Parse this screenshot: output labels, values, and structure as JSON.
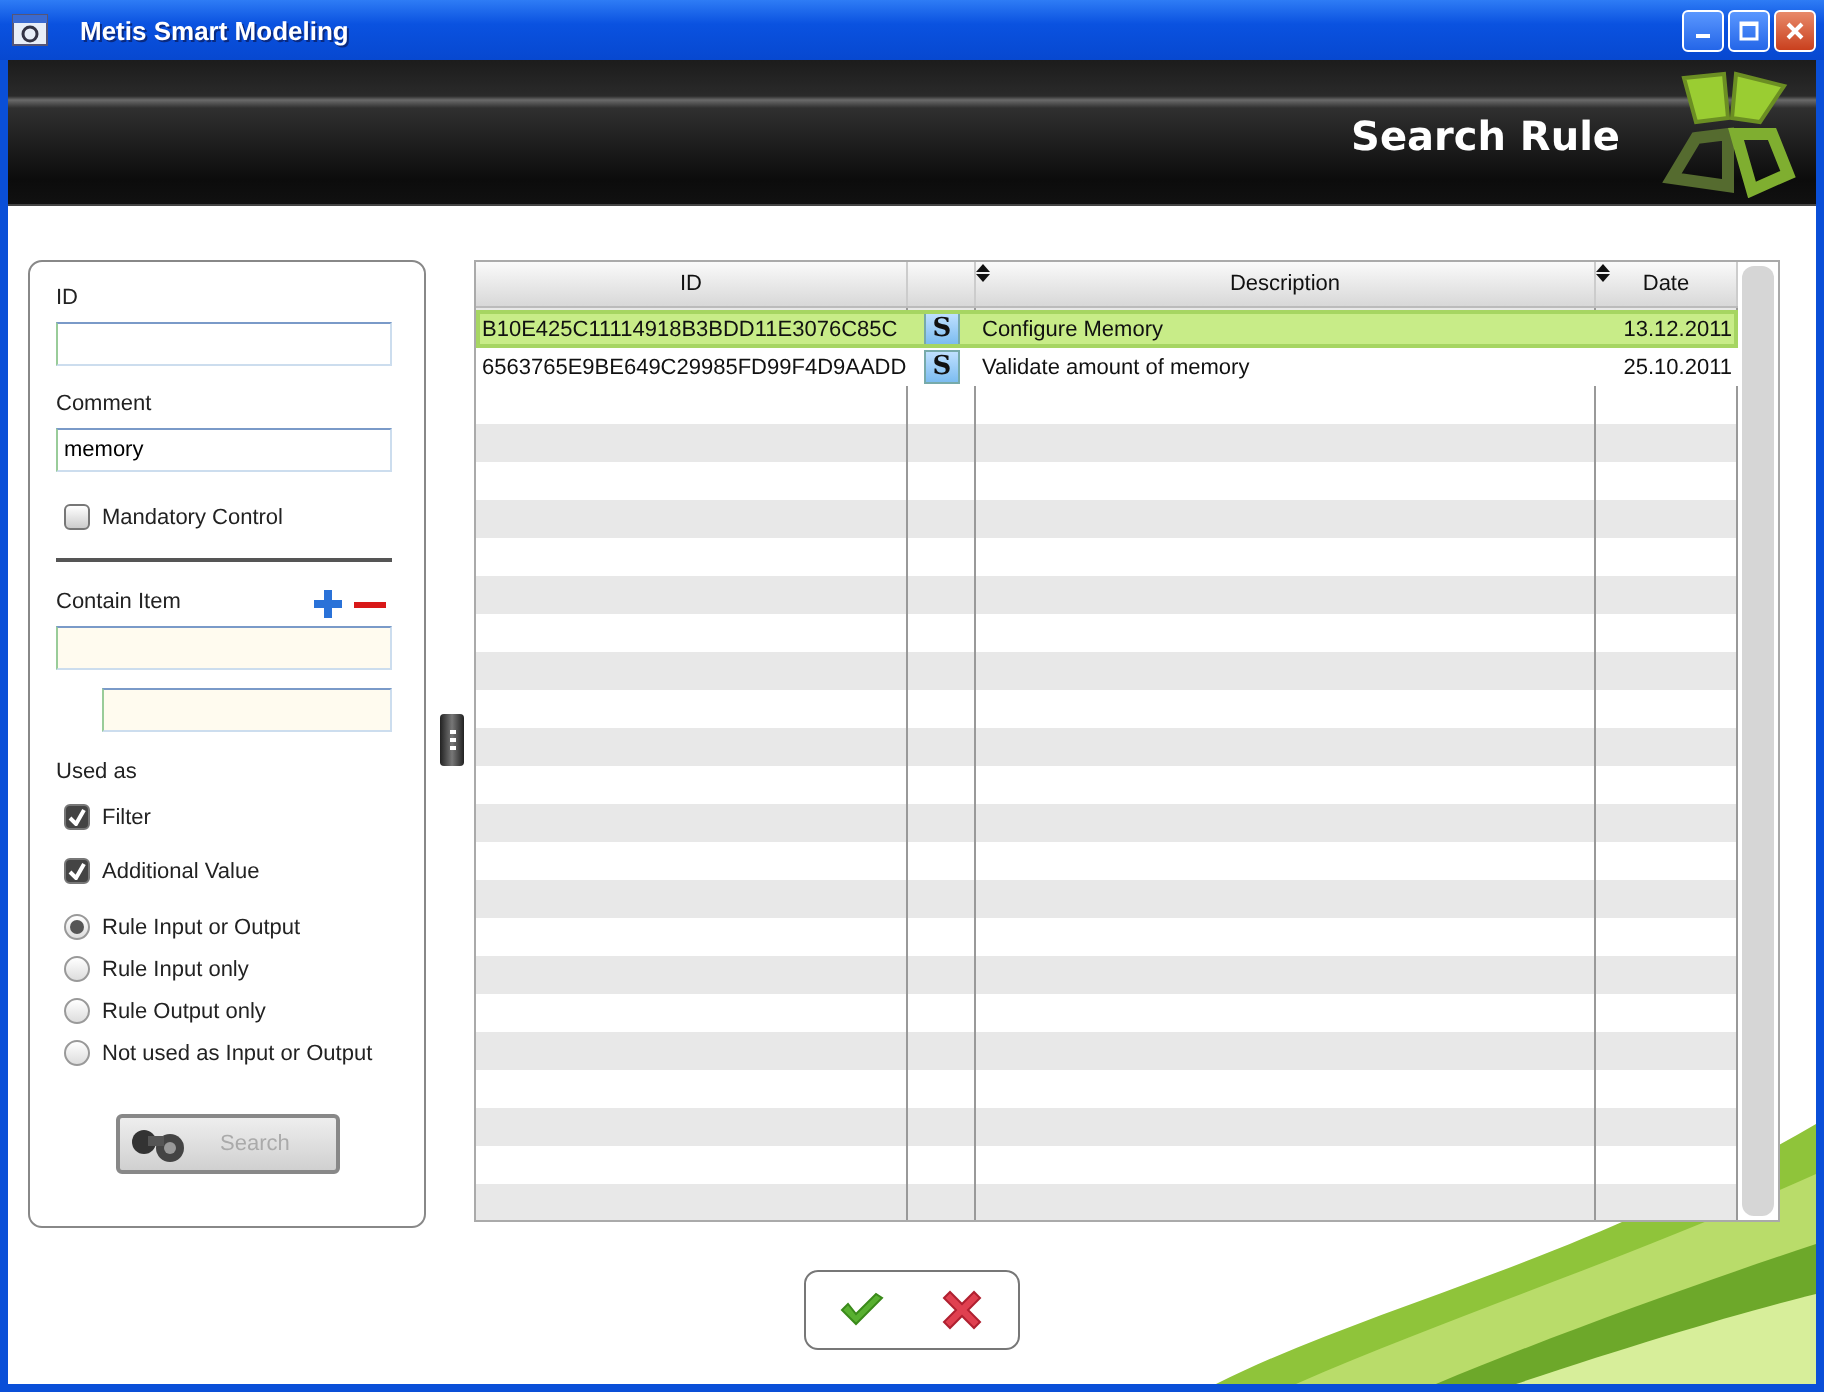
{
  "window": {
    "title": "Metis Smart Modeling"
  },
  "banner": {
    "title": "Search Rule"
  },
  "filter": {
    "id_field": {
      "label": "ID"
    },
    "comment_field": {
      "label": "Comment",
      "value": "memory"
    },
    "mandatory": {
      "label": "Mandatory Control",
      "checked": false
    },
    "contain_item": {
      "label": "Contain Item"
    },
    "used_as": {
      "label": "Used as",
      "checks": [
        {
          "label": "Filter",
          "checked": true
        },
        {
          "label": "Additional Value",
          "checked": true
        }
      ],
      "radios": [
        {
          "label": "Rule Input or Output",
          "selected": true
        },
        {
          "label": "Rule Input only",
          "selected": false
        },
        {
          "label": "Rule Output only",
          "selected": false
        },
        {
          "label": "Not used as Input or Output",
          "selected": false
        }
      ]
    },
    "search_button": {
      "label": "Search",
      "disabled": true
    }
  },
  "table": {
    "columns": [
      "ID",
      "Description",
      "Date"
    ],
    "rows": [
      {
        "id": "B10E425C11114918B3BDD11E3076C85C",
        "badge": "S",
        "description": "Configure Memory",
        "date": "13.12.2011",
        "selected": true
      },
      {
        "id": "6563765E9BE649C29985FD99F4D9AADD",
        "badge": "S",
        "description": "Validate amount of memory",
        "date": "25.10.2011",
        "selected": false
      }
    ]
  }
}
